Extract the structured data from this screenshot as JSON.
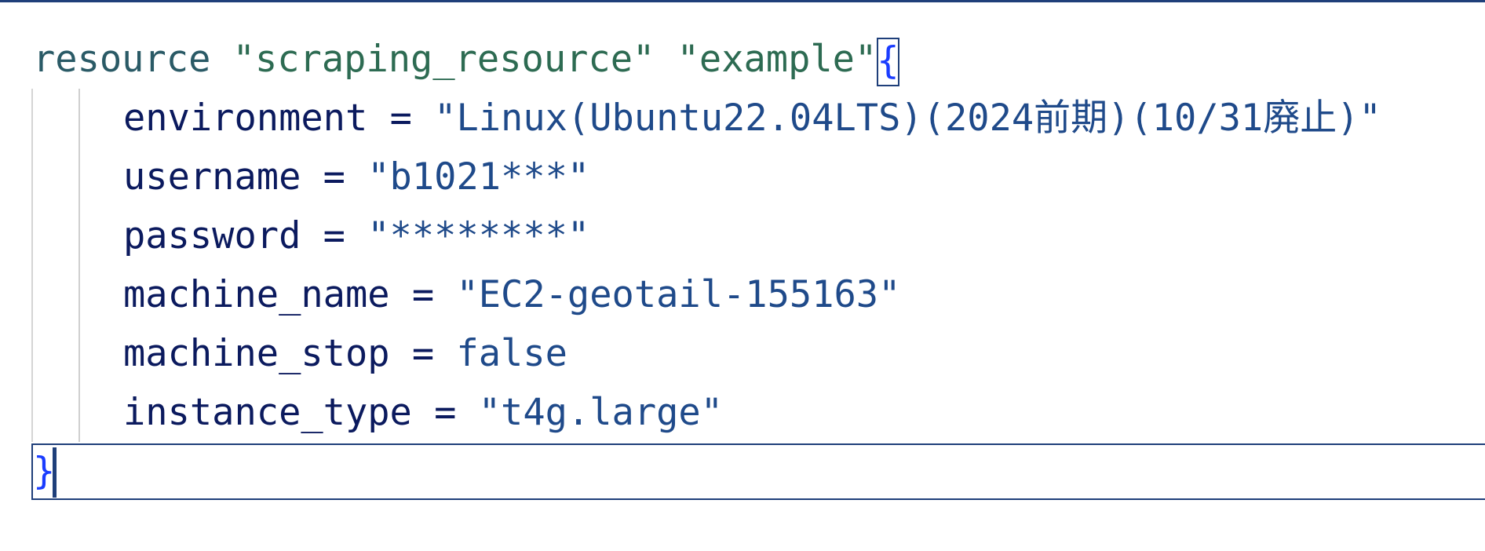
{
  "editor": {
    "lines": [
      {
        "keyword": "resource",
        "type": "\"scraping_resource\"",
        "name": "\"example\"",
        "brace": "{"
      },
      {
        "key": "environment",
        "op": "=",
        "value": "\"Linux(Ubuntu22.04LTS)(2024前期)(10/31廃止)\""
      },
      {
        "key": "username",
        "op": "=",
        "value": "\"b1021***\""
      },
      {
        "key": "password",
        "op": "=",
        "value": "\"********\""
      },
      {
        "key": "machine_name",
        "op": "=",
        "value": "\"EC2-geotail-155163\""
      },
      {
        "key": "machine_stop",
        "op": "=",
        "value": "false"
      },
      {
        "key": "instance_type",
        "op": "=",
        "value": "\"t4g.large\""
      },
      {
        "brace": "}"
      }
    ]
  },
  "colors": {
    "keyword": "#2a5a66",
    "string": "#2d6b52",
    "key": "#0b1a5e",
    "value": "#1f4a8a",
    "brace": "#1a3cff",
    "border": "#1f3f7a"
  }
}
